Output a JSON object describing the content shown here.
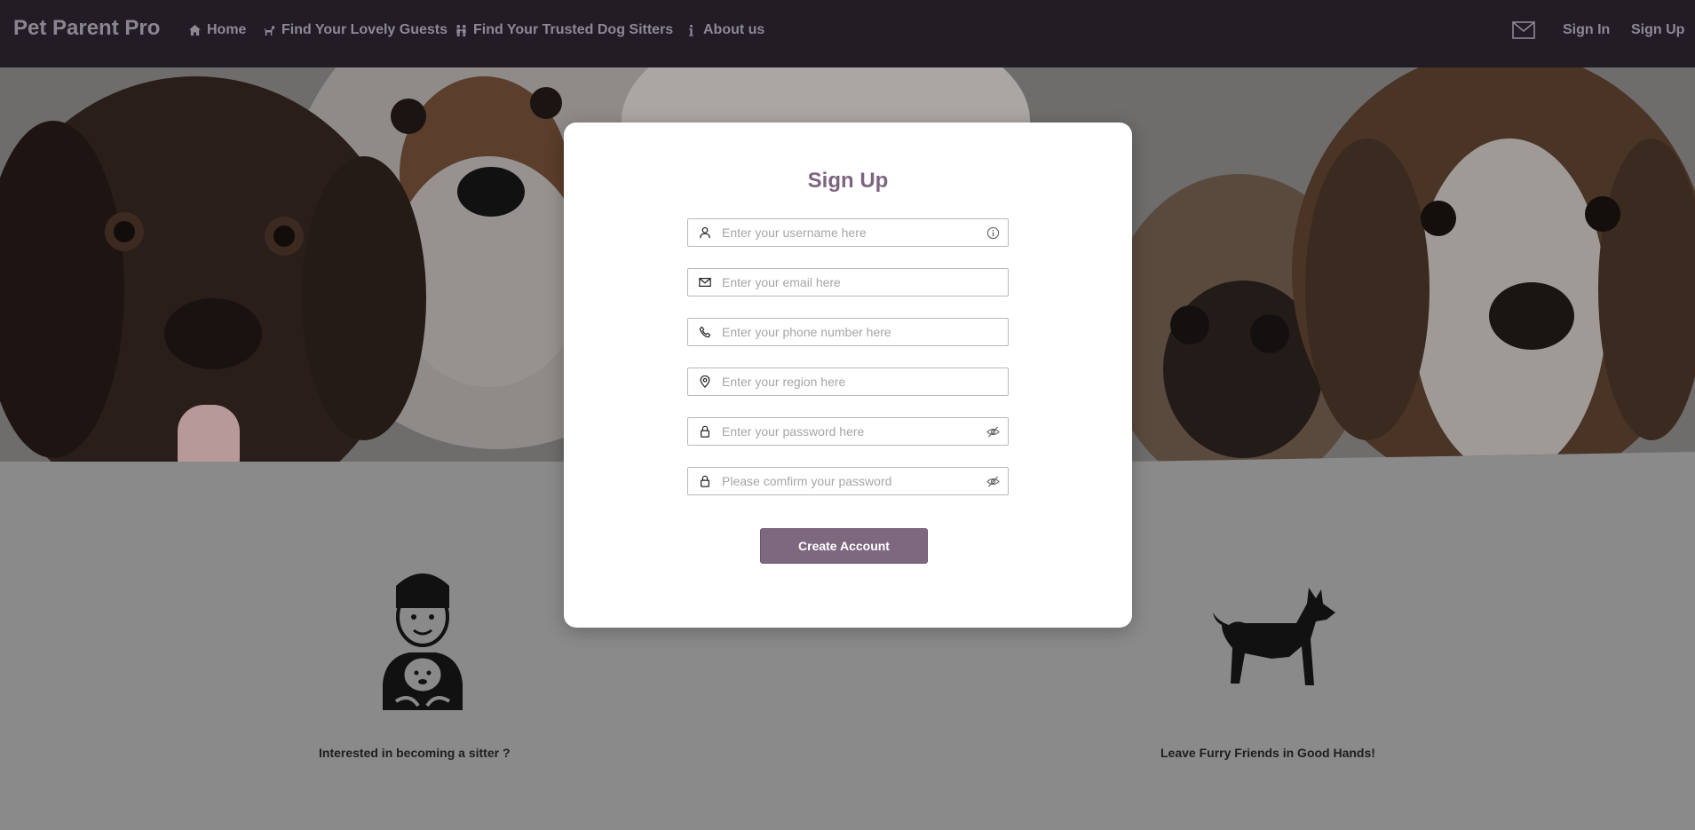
{
  "navbar": {
    "brand": "Pet Parent Pro",
    "items": [
      {
        "label": "Home",
        "icon": "home-icon"
      },
      {
        "label": "Find Your Lovely Guests",
        "icon": "dog-icon"
      },
      {
        "label": "Find Your Trusted Dog Sitters",
        "icon": "people-icon"
      },
      {
        "label": "About us",
        "icon": "info-icon"
      }
    ],
    "mail_icon": "mail-icon",
    "sign_in": "Sign In",
    "sign_up": "Sign Up"
  },
  "hero": {
    "description": "Collage of puppies background image"
  },
  "features": {
    "sitter_caption": "Interested in becoming a sitter ?",
    "owner_caption": "Leave Furry Friends in Good Hands!"
  },
  "modal": {
    "title": "Sign Up",
    "fields": [
      {
        "placeholder": "Enter your username here",
        "icon": "user-icon",
        "trail_icon": "info-circle-icon"
      },
      {
        "placeholder": "Enter your email here",
        "icon": "envelope-icon"
      },
      {
        "placeholder": "Enter your phone number here",
        "icon": "phone-icon"
      },
      {
        "placeholder": "Enter your region here",
        "icon": "location-pin-icon"
      },
      {
        "placeholder": "Enter your password here",
        "icon": "lock-icon",
        "trail_icon": "eye-slash-icon"
      },
      {
        "placeholder": "Please comfirm your password",
        "icon": "lock-icon",
        "trail_icon": "eye-slash-icon"
      }
    ],
    "submit_label": "Create Account"
  },
  "colors": {
    "navbar_bg": "#221d24",
    "accent": "#7e6880",
    "title": "#7d6580"
  }
}
